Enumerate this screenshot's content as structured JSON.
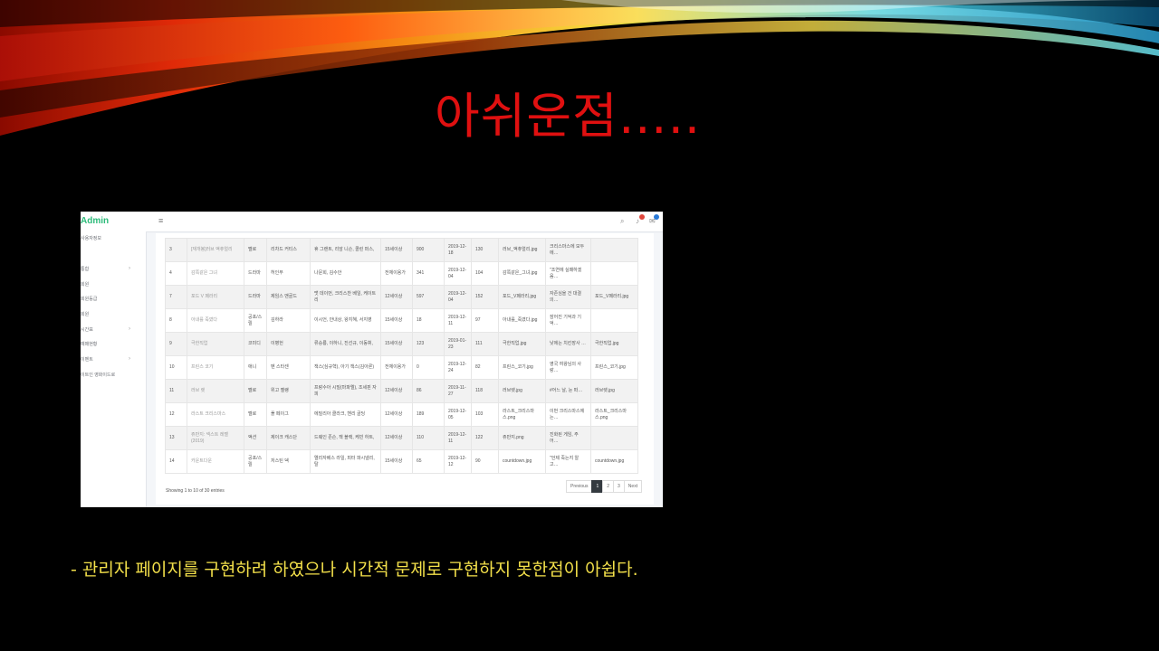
{
  "slide": {
    "title": "아쉬운점…..",
    "caption": "- 관리자 페이지를 구현하려 하였으나 시간적 문제로 구현하지 못한점이 아쉽다.",
    "title_color": "#e01010",
    "caption_color": "#f3e04a"
  },
  "admin_screenshot": {
    "brand": "Admin",
    "hamburger_icon": "≡",
    "navbar_icons": [
      "search-icon",
      "bell-icon",
      "message-icon"
    ],
    "sidebar_items": [
      {
        "label": "사용자정보",
        "has_chevron": false
      },
      {
        "label": "통합",
        "has_chevron": true
      },
      {
        "label": "회원",
        "has_chevron": false
      },
      {
        "label": "회원등급",
        "has_chevron": false
      },
      {
        "label": "회원",
        "has_chevron": false
      },
      {
        "label": "시간표",
        "has_chevron": true
      },
      {
        "label": "예매현황",
        "has_chevron": false
      },
      {
        "label": "이벤트",
        "has_chevron": true
      },
      {
        "label": "이트인 영화이드로",
        "has_chevron": false
      }
    ],
    "table_rows": [
      [
        "3",
        "[재개봉]러브 액츄얼리",
        "멜로",
        "리차드 커티스",
        "휴 그랜트, 리암 니슨, 콜린 퍼스,",
        "15세이상",
        "900",
        "2019-12-18",
        "130",
        "러브_액츄얼리.jpg",
        "크리스마스에 모두에…",
        ""
      ],
      [
        "4",
        "감쪽같은 그녀",
        "드라마",
        "허인무",
        "나문희, 김수안",
        "전체이용가",
        "341",
        "2019-12-04",
        "104",
        "감쪽같은_그녀.jpg",
        "\"조연에 실패하겠음…",
        ""
      ],
      [
        "7",
        "포드 V 페라리",
        "드라마",
        "제임스 맨골드",
        "맷 데이먼, 크리스찬 베일, 케이트리",
        "12세이상",
        "597",
        "2019-12-04",
        "152",
        "포드_V페라리.jpg",
        "자존심을 건 대결의…",
        "포드_V페라리.jpg"
      ],
      [
        "8",
        "아내를 죽였다",
        "공포/스릴",
        "김하라",
        "이시언, 안내상, 왕지혜, 서지영",
        "15세이상",
        "18",
        "2019-12-11",
        "97",
        "아내를_죽였다.jpg",
        "잠어진 기억과 기억…",
        ""
      ],
      [
        "9",
        "극한직업",
        "코미디",
        "이병헌",
        "류승룡, 이하니, 진선규, 이동휘,",
        "15세이상",
        "123",
        "2019-01-23",
        "111",
        "극한직업.jpg",
        "낮에는 치킨장사 …",
        "극한직업.jpg"
      ],
      [
        "10",
        "프린스 코기",
        "애니",
        "벤 스타센",
        "잭스(심규혁), 아기 잭스(김아론)",
        "전체이용가",
        "0",
        "2019-12-24",
        "82",
        "프린스_코기.jpg",
        "영국 여왕님의 사랑…",
        "프린스_코기.jpg"
      ],
      [
        "11",
        "러브 렛",
        "멜로",
        "위고 젤랭",
        "프랑수아 시빌(마파엘), 조세핀 자피",
        "12세이상",
        "86",
        "2019-11-27",
        "118",
        "러브렛.jpg",
        "#어느 날, 눈 떠…",
        "러브렛.jpg"
      ],
      [
        "12",
        "라스트 크리스마스",
        "멜로",
        "폴 페이그",
        "에밀리아 클라크, 헨리 골딩",
        "12세이상",
        "189",
        "2019-12-05",
        "103",
        "라스트_크리스마스.png",
        "이번 크리스마스에는…",
        "라스트_크리스마스.png"
      ],
      [
        "13",
        "쥬만지: 넥스트 레벨 (2019)",
        "액션",
        "제이크 캐스단",
        "드웨인 존슨, 잭 블랙, 케빈 하트,",
        "12세이상",
        "110",
        "2019-12-11",
        "122",
        "쥬만지.png",
        "진화된 게임, 주어…",
        ""
      ],
      [
        "14",
        "카운트다운",
        "공포/스릴",
        "저스틴 덱",
        "엘리자베스 라일, 피터 파시넬리, 탈",
        "15세이상",
        "65",
        "2019-12-12",
        "90",
        "countdown.jpg",
        "\"언제 죽는지 알고…",
        "countdown.jpg"
      ]
    ],
    "entries_info": "Showing 1 to 10 of 30 entries",
    "pagination": {
      "previous": "Previous",
      "pages": [
        "1",
        "2",
        "3"
      ],
      "current": "1",
      "next": "Next"
    }
  }
}
